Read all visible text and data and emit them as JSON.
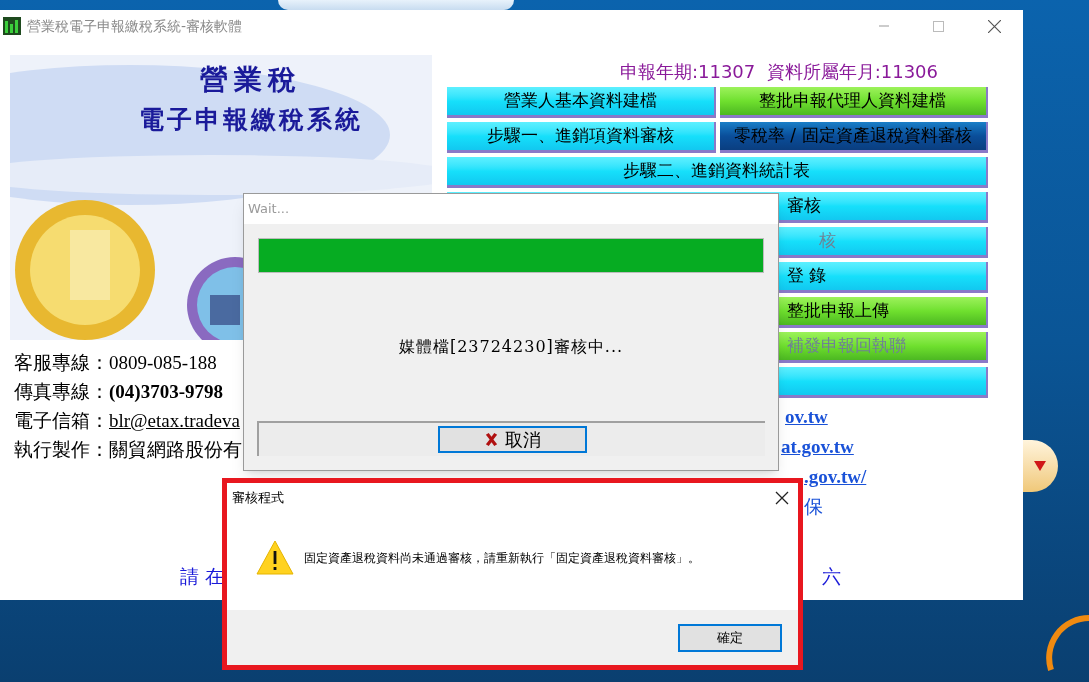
{
  "window": {
    "title": "營業稅電子申報繳稅系統-審核軟體"
  },
  "banner": {
    "title": "營業稅",
    "subtitle": "電子申報繳稅系統"
  },
  "period": "申報年期:11307  資料所屬年月:11306",
  "buttons": [
    {
      "label": "營業人基本資料建檔",
      "kind": "cyan",
      "disabled": false,
      "half": true
    },
    {
      "label": "整批申報代理人資料建檔",
      "kind": "green",
      "disabled": false,
      "half": true
    },
    {
      "label": "步驟一、進銷項資料審核",
      "kind": "cyan",
      "disabled": false,
      "half": true
    },
    {
      "label": "零稅率 / 固定資產退稅資料審核",
      "kind": "navy",
      "disabled": false,
      "half": true
    },
    {
      "label": "步驟二、進銷資料統計表",
      "kind": "cyan",
      "disabled": false,
      "half": false
    },
    {
      "label": "審核",
      "kind": "cyan",
      "disabled": false,
      "half": false
    },
    {
      "label": "核",
      "kind": "cyan",
      "disabled": true,
      "half": false
    },
    {
      "label": "登 錄",
      "kind": "cyan",
      "disabled": false,
      "half": false
    },
    {
      "label": "整批申報上傳",
      "kind": "green",
      "disabled": false,
      "half": false
    },
    {
      "label": "補發申報回執聯",
      "kind": "green",
      "disabled": true,
      "half": false
    },
    {
      "kind": "cyan",
      "half": false
    }
  ],
  "contacts": [
    {
      "label": "客服專線：",
      "value": "0809-085-188",
      "kind": "plain"
    },
    {
      "label": "傳真專線：",
      "value": "(04)3703-9798",
      "kind": "bold"
    },
    {
      "label": "電子信箱：",
      "value": "blr@etax.tradeva",
      "kind": "link"
    },
    {
      "label": "執行製作：",
      "value": "關貿網路股份有",
      "kind": "plain"
    }
  ],
  "links": [
    "ov.tw",
    "at.gov.tw",
    ".gov.tw/"
  ],
  "note": "保",
  "footer": {
    "left": "請 在",
    "right": "六"
  },
  "wait_dialog": {
    "title": "Wait...",
    "progress": {
      "level": 1
    },
    "message": "媒體檔[23724230]審核中...",
    "cancel": "取消"
  },
  "message_box": {
    "title": "審核程式",
    "message": "固定資產退稅資料尚未通過審核，請重新執行「固定資產退稅資料審核」。",
    "ok": "確定"
  }
}
